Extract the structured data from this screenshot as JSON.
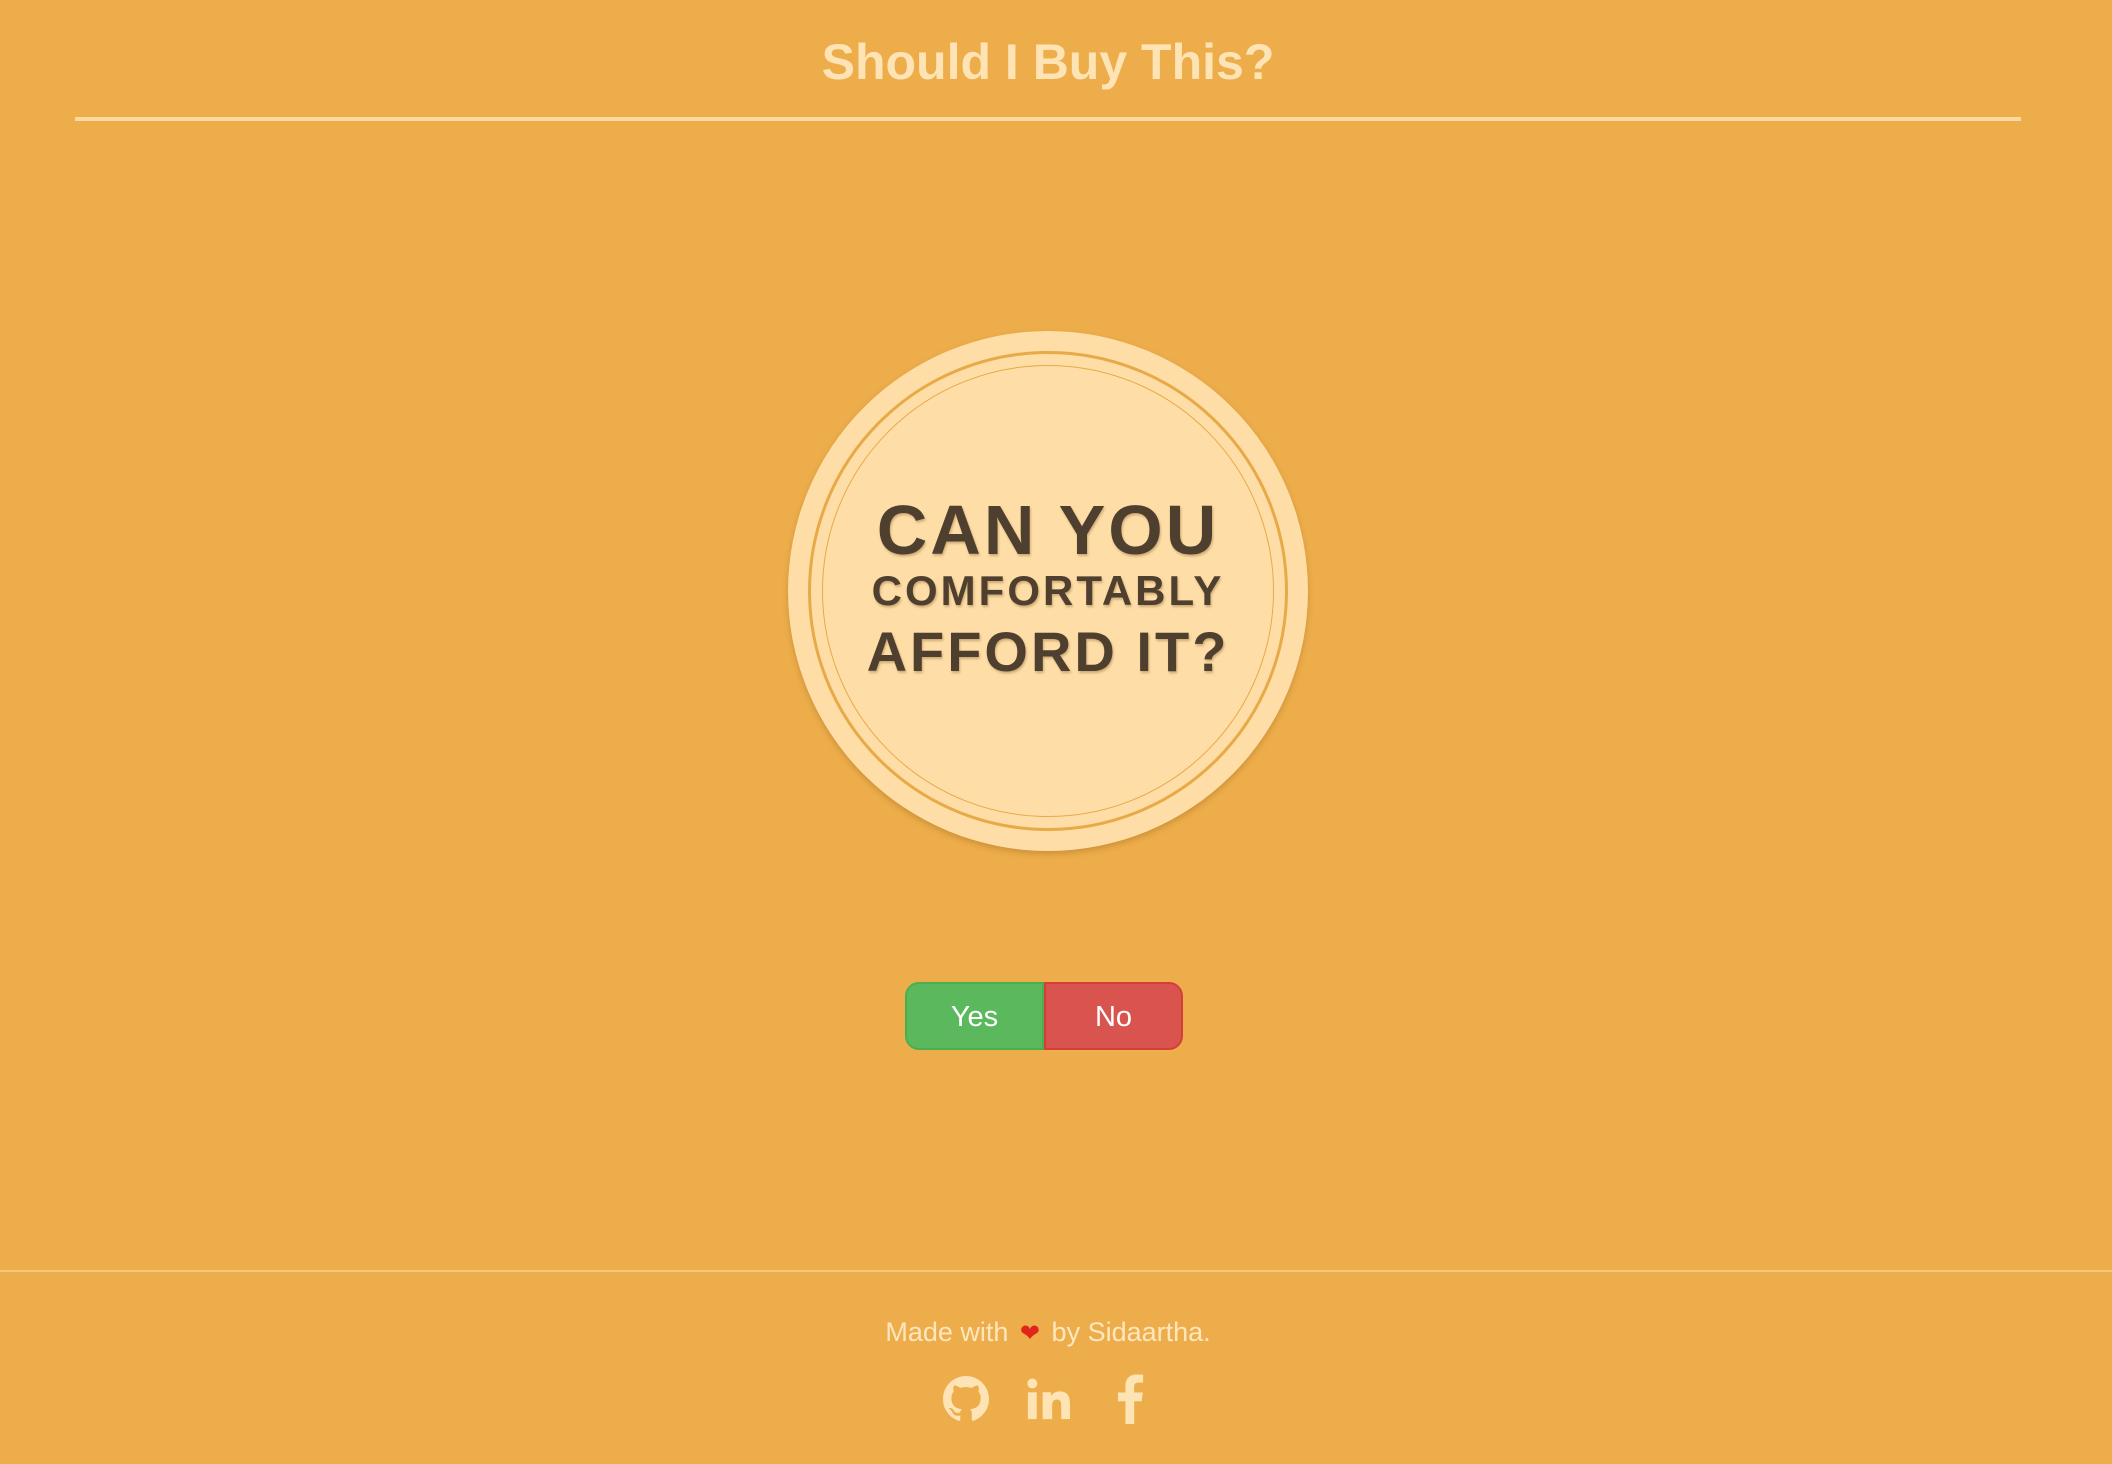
{
  "header": {
    "title": "Should I Buy This?"
  },
  "question": {
    "line1": "CAN YOU",
    "line2": "COMFORTABLY",
    "line3": "AFFORD IT?"
  },
  "answers": {
    "yes_label": "Yes",
    "no_label": "No"
  },
  "footer": {
    "made_with": "Made with",
    "heart_glyph": "❤",
    "by_author": "by Sidaartha.",
    "social_icons": [
      "github-icon",
      "linkedin-icon",
      "facebook-icon"
    ]
  },
  "colors": {
    "background": "#EDAD4B",
    "title_text": "#FEE3B4",
    "badge_fill": "#FEDDA6",
    "badge_text": "#4E3F2F",
    "yes_button": "#5CB85C",
    "no_button": "#D9534F",
    "heart": "#E0261A",
    "icon": "#FEE3B4"
  }
}
